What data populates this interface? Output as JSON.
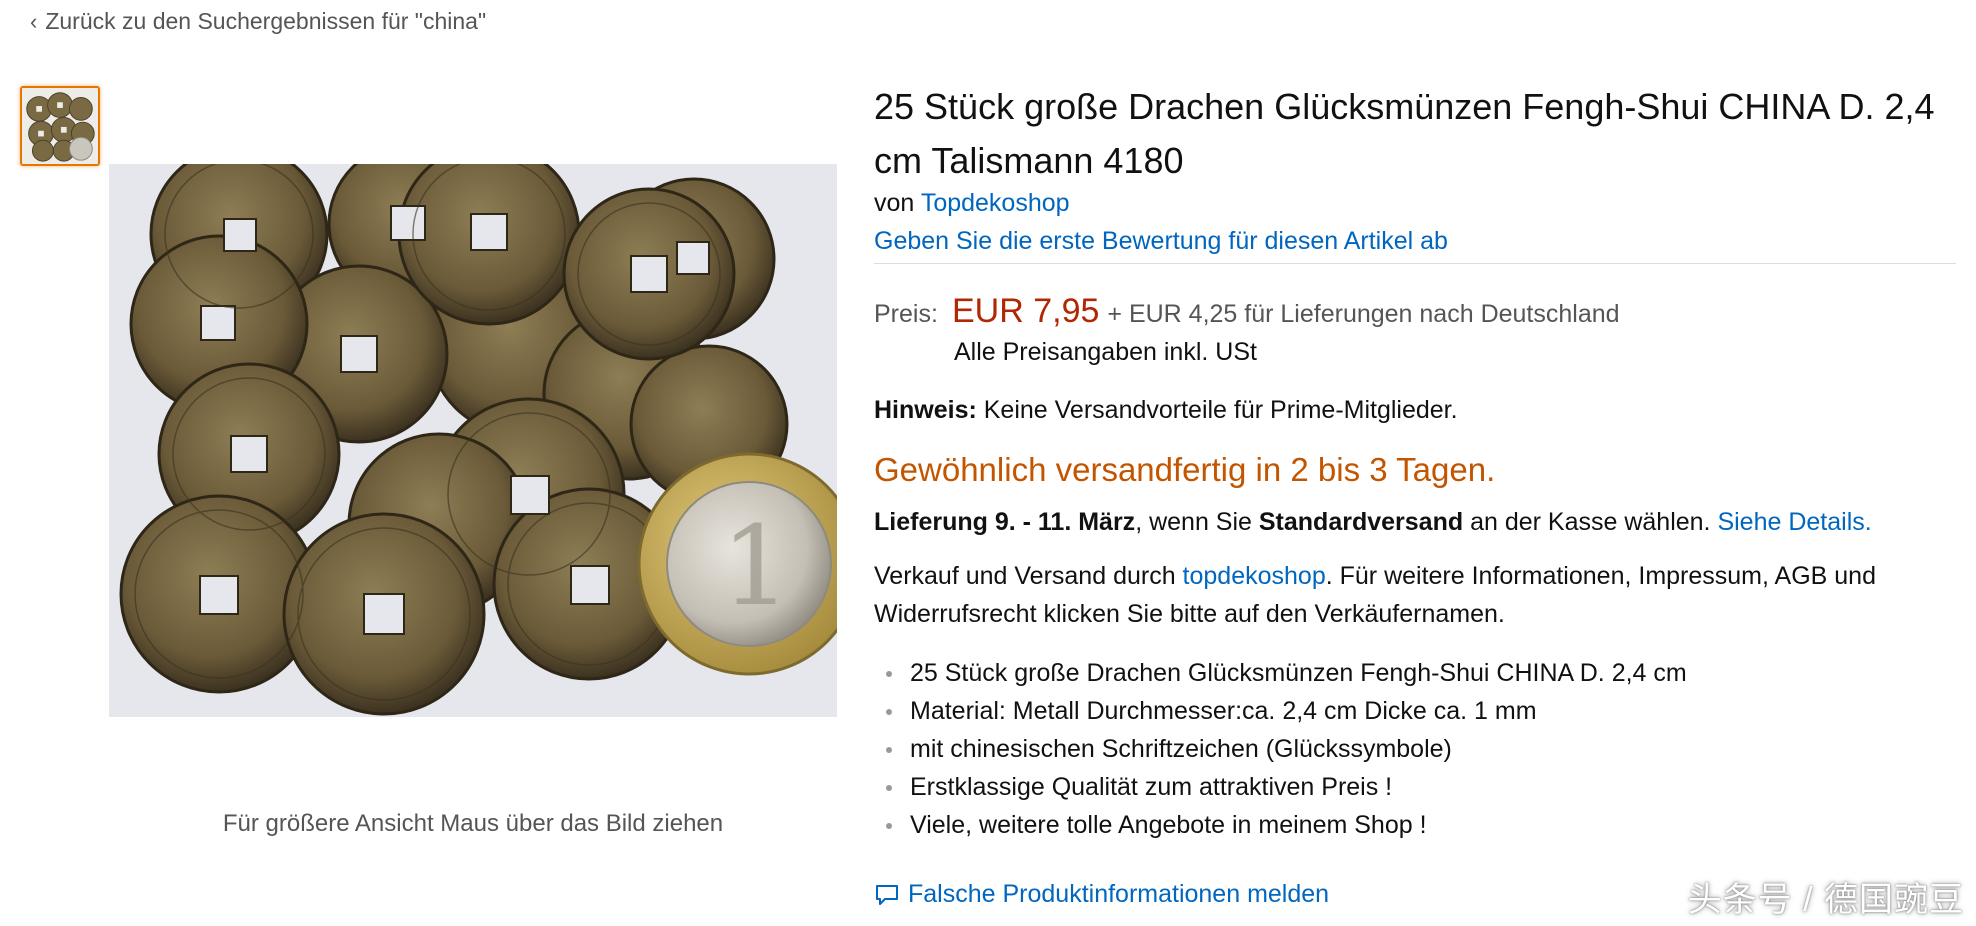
{
  "breadcrumb": {
    "back_label": "Zurück zu den Suchergebnissen für \"china\""
  },
  "gallery": {
    "hover_hint": "Für größere Ansicht Maus über das Bild ziehen"
  },
  "product": {
    "title": "25 Stück große Drachen Glücksmünzen Fengh-Shui CHINA D. 2,4 cm Talismann 4180",
    "by_prefix": "von",
    "brand": "Topdekoshop",
    "review_link": "Geben Sie die erste Bewertung für diesen Artikel ab"
  },
  "pricing": {
    "label": "Preis:",
    "price": "EUR 7,95",
    "shipping": "+ EUR 4,25 für Lieferungen nach Deutschland",
    "vat_note": "Alle Preisangaben inkl. USt"
  },
  "notice": {
    "label": "Hinweis:",
    "text": "Keine Versandvorteile für Prime-Mitglieder."
  },
  "availability": "Gewöhnlich versandfertig in 2 bis 3 Tagen.",
  "delivery": {
    "prefix": "Lieferung 9. - 11. März",
    "middle": ", wenn Sie ",
    "method": "Standardversand",
    "suffix": " an der Kasse wählen. ",
    "details_link": "Siehe Details."
  },
  "seller": {
    "prefix": "Verkauf und Versand durch ",
    "name": "topdekoshop",
    "suffix": ". Für weitere Informationen, Impressum, AGB und Widerrufsrecht klicken Sie bitte auf den Verkäufernamen."
  },
  "bullets": [
    "25 Stück große Drachen Glücksmünzen Fengh-Shui CHINA D. 2,4 cm",
    "Material: Metall Durchmesser:ca. 2,4 cm Dicke ca. 1 mm",
    "mit chinesischen Schriftzeichen (Glückssymbole)",
    "Erstklassige Qualität zum attraktiven Preis !",
    "Viele, weitere tolle Angebote in meinem Shop !"
  ],
  "report_link": "Falsche Produktinformationen melden",
  "watermark": "头条号 / 德国豌豆",
  "colors": {
    "link": "#0066c0",
    "price": "#b12704",
    "availability": "#c45500",
    "thumb_highlight": "#e77600"
  },
  "icons": {
    "back": "chevron-left-icon",
    "report": "speech-bubble-icon"
  }
}
